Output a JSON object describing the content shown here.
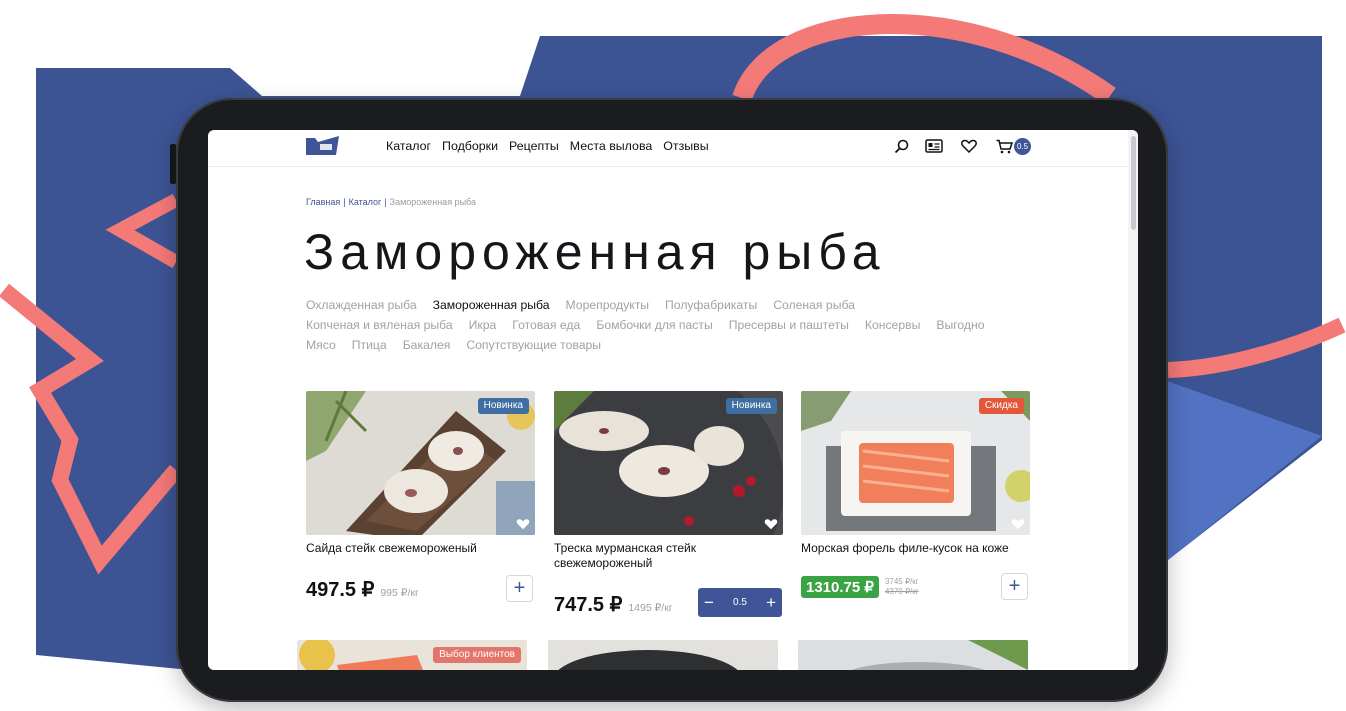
{
  "colors": {
    "brand_blue": "#3f5597",
    "deco_blue": "#3d5494",
    "deco_pink": "#f47a78",
    "badge_new": "#3f6ea3",
    "badge_sale": "#e3573b",
    "badge_choice": "#e4756a",
    "sale_green": "#3aa445"
  },
  "header": {
    "nav": [
      "Каталог",
      "Подборки",
      "Рецепты",
      "Места вылова",
      "Отзывы"
    ],
    "icons": [
      "search-icon",
      "profile-card-icon",
      "heart-icon",
      "cart-icon"
    ],
    "cart_count": "0.5"
  },
  "breadcrumb": {
    "home": "Главная",
    "catalog": "Каталог",
    "current": "Замороженная рыба",
    "separator": "|"
  },
  "title": "Замороженная рыба",
  "categories": {
    "row1": [
      "Охлажденная рыба",
      "Замороженная рыба",
      "Морепродукты",
      "Полуфабрикаты",
      "Соленая рыба"
    ],
    "row2": [
      "Копченая и вяленая рыба",
      "Икра",
      "Готовая еда",
      "Бомбочки для пасты",
      "Пресервы и паштеты",
      "Консервы",
      "Выгодно"
    ],
    "row3": [
      "Мясо",
      "Птица",
      "Бакалея",
      "Сопутствующие товары"
    ],
    "active": "Замороженная рыба"
  },
  "products": [
    {
      "badge": "Новинка",
      "name": "Сайда стейк свежемороженый",
      "price": "497.5 ₽",
      "old_price": "995 ₽/кг",
      "add_label": "+"
    },
    {
      "badge": "Новинка",
      "name": "Треска мурманская стейк свежемороженый",
      "price": "747.5 ₽",
      "old_price": "1495 ₽/кг",
      "stepper": {
        "minus": "−",
        "value": "0.5",
        "plus": "+"
      }
    },
    {
      "badge": "Скидка",
      "name": "Морская форель филе-кусок на коже",
      "price": "1310.75 ₽",
      "price_per_kg": "3745 ₽/кг",
      "old_price": "4370 ₽/кг",
      "add_label": "+"
    }
  ],
  "second_row": {
    "first_badge": "Выбор клиентов"
  }
}
